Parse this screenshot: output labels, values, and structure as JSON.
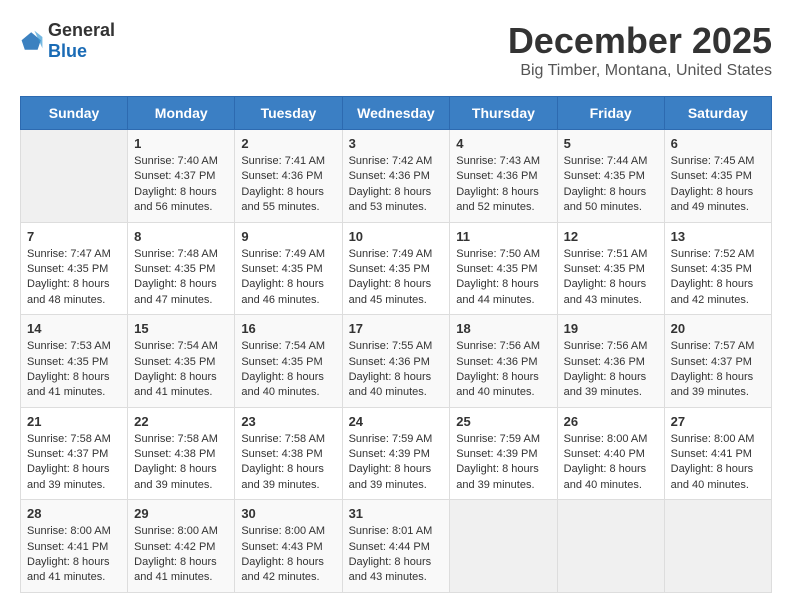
{
  "header": {
    "logo_general": "General",
    "logo_blue": "Blue",
    "month_title": "December 2025",
    "location": "Big Timber, Montana, United States"
  },
  "days_of_week": [
    "Sunday",
    "Monday",
    "Tuesday",
    "Wednesday",
    "Thursday",
    "Friday",
    "Saturday"
  ],
  "weeks": [
    [
      {
        "day": "",
        "info": ""
      },
      {
        "day": "1",
        "info": "Sunrise: 7:40 AM\nSunset: 4:37 PM\nDaylight: 8 hours\nand 56 minutes."
      },
      {
        "day": "2",
        "info": "Sunrise: 7:41 AM\nSunset: 4:36 PM\nDaylight: 8 hours\nand 55 minutes."
      },
      {
        "day": "3",
        "info": "Sunrise: 7:42 AM\nSunset: 4:36 PM\nDaylight: 8 hours\nand 53 minutes."
      },
      {
        "day": "4",
        "info": "Sunrise: 7:43 AM\nSunset: 4:36 PM\nDaylight: 8 hours\nand 52 minutes."
      },
      {
        "day": "5",
        "info": "Sunrise: 7:44 AM\nSunset: 4:35 PM\nDaylight: 8 hours\nand 50 minutes."
      },
      {
        "day": "6",
        "info": "Sunrise: 7:45 AM\nSunset: 4:35 PM\nDaylight: 8 hours\nand 49 minutes."
      }
    ],
    [
      {
        "day": "7",
        "info": "Sunrise: 7:47 AM\nSunset: 4:35 PM\nDaylight: 8 hours\nand 48 minutes."
      },
      {
        "day": "8",
        "info": "Sunrise: 7:48 AM\nSunset: 4:35 PM\nDaylight: 8 hours\nand 47 minutes."
      },
      {
        "day": "9",
        "info": "Sunrise: 7:49 AM\nSunset: 4:35 PM\nDaylight: 8 hours\nand 46 minutes."
      },
      {
        "day": "10",
        "info": "Sunrise: 7:49 AM\nSunset: 4:35 PM\nDaylight: 8 hours\nand 45 minutes."
      },
      {
        "day": "11",
        "info": "Sunrise: 7:50 AM\nSunset: 4:35 PM\nDaylight: 8 hours\nand 44 minutes."
      },
      {
        "day": "12",
        "info": "Sunrise: 7:51 AM\nSunset: 4:35 PM\nDaylight: 8 hours\nand 43 minutes."
      },
      {
        "day": "13",
        "info": "Sunrise: 7:52 AM\nSunset: 4:35 PM\nDaylight: 8 hours\nand 42 minutes."
      }
    ],
    [
      {
        "day": "14",
        "info": "Sunrise: 7:53 AM\nSunset: 4:35 PM\nDaylight: 8 hours\nand 41 minutes."
      },
      {
        "day": "15",
        "info": "Sunrise: 7:54 AM\nSunset: 4:35 PM\nDaylight: 8 hours\nand 41 minutes."
      },
      {
        "day": "16",
        "info": "Sunrise: 7:54 AM\nSunset: 4:35 PM\nDaylight: 8 hours\nand 40 minutes."
      },
      {
        "day": "17",
        "info": "Sunrise: 7:55 AM\nSunset: 4:36 PM\nDaylight: 8 hours\nand 40 minutes."
      },
      {
        "day": "18",
        "info": "Sunrise: 7:56 AM\nSunset: 4:36 PM\nDaylight: 8 hours\nand 40 minutes."
      },
      {
        "day": "19",
        "info": "Sunrise: 7:56 AM\nSunset: 4:36 PM\nDaylight: 8 hours\nand 39 minutes."
      },
      {
        "day": "20",
        "info": "Sunrise: 7:57 AM\nSunset: 4:37 PM\nDaylight: 8 hours\nand 39 minutes."
      }
    ],
    [
      {
        "day": "21",
        "info": "Sunrise: 7:58 AM\nSunset: 4:37 PM\nDaylight: 8 hours\nand 39 minutes."
      },
      {
        "day": "22",
        "info": "Sunrise: 7:58 AM\nSunset: 4:38 PM\nDaylight: 8 hours\nand 39 minutes."
      },
      {
        "day": "23",
        "info": "Sunrise: 7:58 AM\nSunset: 4:38 PM\nDaylight: 8 hours\nand 39 minutes."
      },
      {
        "day": "24",
        "info": "Sunrise: 7:59 AM\nSunset: 4:39 PM\nDaylight: 8 hours\nand 39 minutes."
      },
      {
        "day": "25",
        "info": "Sunrise: 7:59 AM\nSunset: 4:39 PM\nDaylight: 8 hours\nand 39 minutes."
      },
      {
        "day": "26",
        "info": "Sunrise: 8:00 AM\nSunset: 4:40 PM\nDaylight: 8 hours\nand 40 minutes."
      },
      {
        "day": "27",
        "info": "Sunrise: 8:00 AM\nSunset: 4:41 PM\nDaylight: 8 hours\nand 40 minutes."
      }
    ],
    [
      {
        "day": "28",
        "info": "Sunrise: 8:00 AM\nSunset: 4:41 PM\nDaylight: 8 hours\nand 41 minutes."
      },
      {
        "day": "29",
        "info": "Sunrise: 8:00 AM\nSunset: 4:42 PM\nDaylight: 8 hours\nand 41 minutes."
      },
      {
        "day": "30",
        "info": "Sunrise: 8:00 AM\nSunset: 4:43 PM\nDaylight: 8 hours\nand 42 minutes."
      },
      {
        "day": "31",
        "info": "Sunrise: 8:01 AM\nSunset: 4:44 PM\nDaylight: 8 hours\nand 43 minutes."
      },
      {
        "day": "",
        "info": ""
      },
      {
        "day": "",
        "info": ""
      },
      {
        "day": "",
        "info": ""
      }
    ]
  ]
}
